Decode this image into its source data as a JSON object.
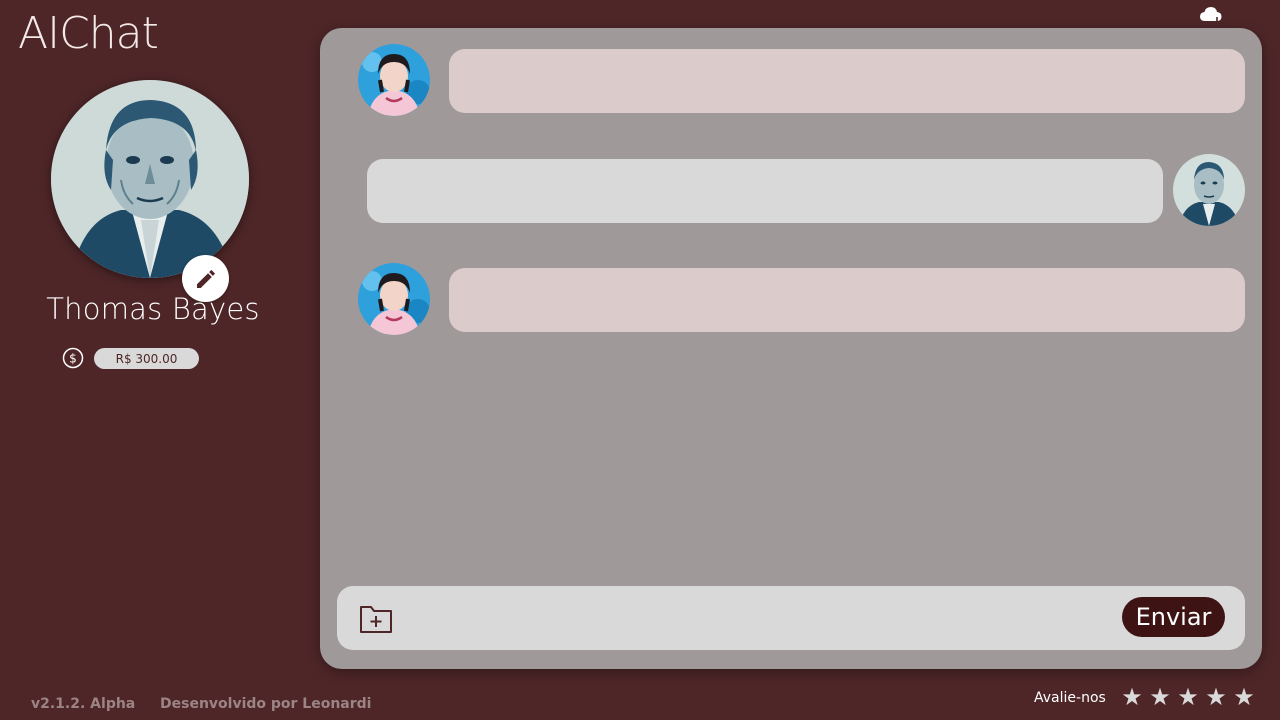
{
  "app": {
    "logo": "AIChat"
  },
  "profile": {
    "name": "Thomas Bayes",
    "balance": "R$ 300.00"
  },
  "icons": {
    "cloud": "cloud-download-icon",
    "edit": "pencil-icon",
    "balance": "dollar-circle-icon",
    "attach": "folder-plus-icon",
    "star": "star-icon"
  },
  "chat": {
    "messages": [
      {
        "role": "bot",
        "text": ""
      },
      {
        "role": "user",
        "text": ""
      },
      {
        "role": "bot",
        "text": ""
      }
    ],
    "input_placeholder": "",
    "send_label": "Enviar"
  },
  "footer": {
    "version": "v2.1.2. Alpha",
    "developer": "Desenvolvido por Leonardi",
    "rate_label": "Avalie-nos",
    "stars": [
      "★",
      "★",
      "★",
      "★",
      "★"
    ]
  },
  "colors": {
    "background": "#4e2628",
    "panel": "#a09999",
    "bot_bubble": "#dbcbcb",
    "user_bubble": "#d9d9d9",
    "send_button": "#3d1314"
  }
}
